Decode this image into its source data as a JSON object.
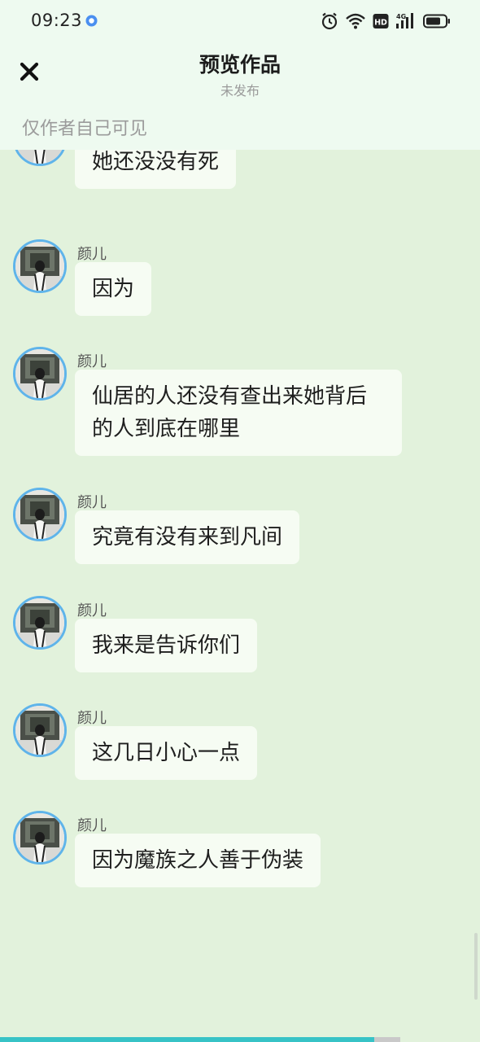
{
  "status_bar": {
    "time": "09:23",
    "network": "4G",
    "hd_label": "HD"
  },
  "header": {
    "title": "预览作品",
    "subtitle": "未发布",
    "visibility_note": "仅作者自己可见"
  },
  "messages": [
    {
      "sender": "",
      "text": "她还没没有死"
    },
    {
      "sender": "颜儿",
      "text": "因为"
    },
    {
      "sender": "颜儿",
      "text": "仙居的人还没有查出来她背后的人到底在哪里"
    },
    {
      "sender": "颜儿",
      "text": "究竟有没有来到凡间"
    },
    {
      "sender": "颜儿",
      "text": "我来是告诉你们"
    },
    {
      "sender": "颜儿",
      "text": "这几日小心一点"
    },
    {
      "sender": "颜儿",
      "text": "因为魔族之人善于伪装"
    }
  ],
  "colors": {
    "background": "#e2f2dc",
    "header_bg": "#eefaf0",
    "bubble_bg": "#f6fcf3",
    "avatar_ring": "#5fb4ea",
    "progress_bar": "#37c3c6"
  },
  "icons": {
    "close": "close-icon",
    "alarm": "alarm-icon",
    "wifi": "wifi-icon",
    "signal": "signal-icon",
    "battery": "battery-icon",
    "location": "location-dot-icon"
  }
}
